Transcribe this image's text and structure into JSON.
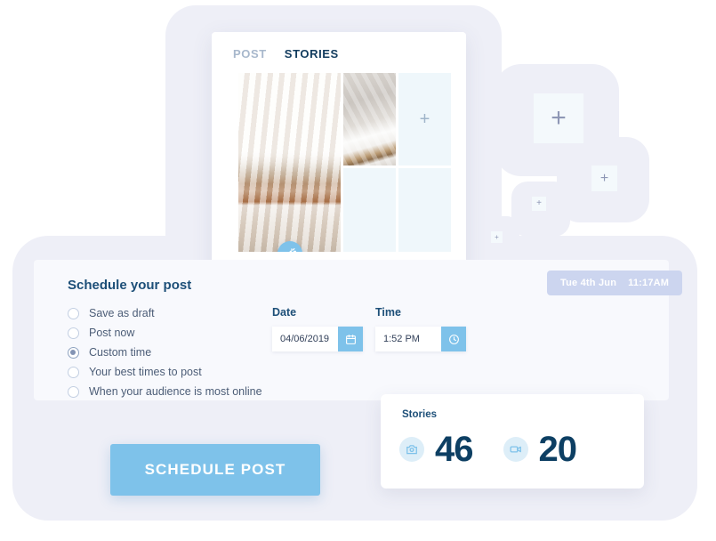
{
  "composer": {
    "tabs": [
      {
        "label": "POST",
        "active": false
      },
      {
        "label": "STORIES",
        "active": true
      }
    ],
    "media_grid": [
      {
        "name": "clothing-rack-photo",
        "type": "photo"
      },
      {
        "name": "linen-fabric-photo",
        "type": "photo"
      },
      {
        "name": "add-media-placeholder",
        "type": "placeholder",
        "glyph": "+"
      },
      {
        "name": "add-media-placeholder",
        "type": "placeholder",
        "glyph": ""
      },
      {
        "name": "add-media-placeholder",
        "type": "placeholder",
        "glyph": ""
      }
    ],
    "magic_icon": "magic-wand-icon"
  },
  "schedule": {
    "title": "Schedule your post",
    "options": [
      {
        "label": "Save as draft",
        "selected": false
      },
      {
        "label": "Post now",
        "selected": false
      },
      {
        "label": "Custom time",
        "selected": true
      },
      {
        "label": "Your best times to post",
        "selected": false
      },
      {
        "label": "When your audience is most online",
        "selected": false
      }
    ],
    "date": {
      "label": "Date",
      "value": "04/06/2019",
      "icon": "calendar-icon"
    },
    "time": {
      "label": "Time",
      "value": "1:52 PM",
      "icon": "clock-icon"
    },
    "badge": {
      "day": "Tue 4th Jun",
      "time": "11:17AM"
    },
    "submit_label": "SCHEDULE POST"
  },
  "stats": {
    "title": "Stories",
    "items": [
      {
        "icon": "camera-icon",
        "value": "46"
      },
      {
        "icon": "video-camera-icon",
        "value": "20"
      }
    ]
  },
  "floating_tiles": [
    {
      "glyph": "+"
    },
    {
      "glyph": "+"
    },
    {
      "glyph": "+"
    },
    {
      "glyph": "+"
    }
  ],
  "colors": {
    "accent_blue": "#7ec2ea",
    "navy": "#0d3f63",
    "heading_blue": "#1d4f78",
    "shell_lavender": "#eeeff7",
    "placeholder_blue": "#eff7fb",
    "badge_lavender": "#ccd5ef"
  }
}
